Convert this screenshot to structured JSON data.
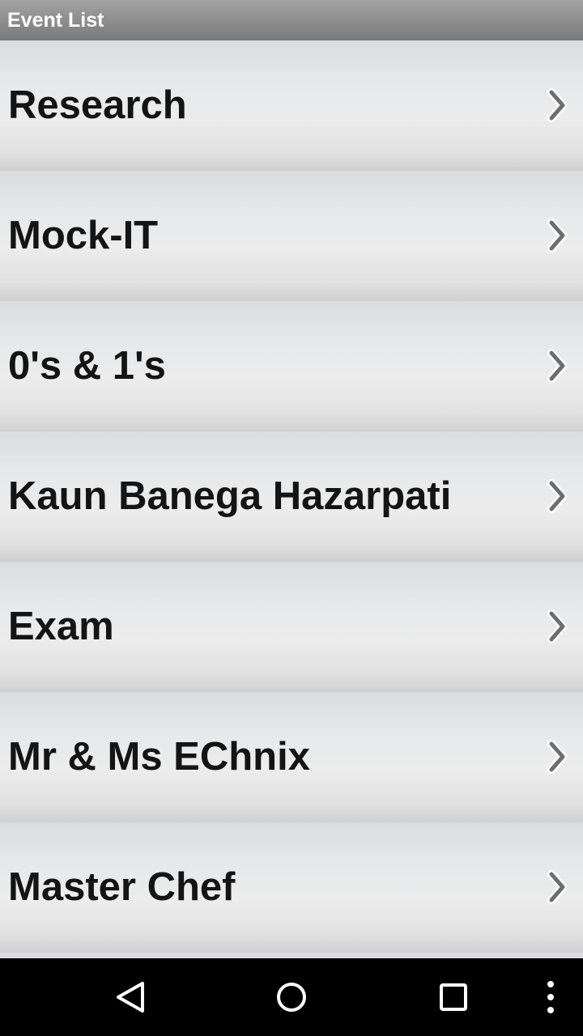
{
  "header": {
    "title": "Event List"
  },
  "events": [
    {
      "label": "Research"
    },
    {
      "label": "Mock-IT"
    },
    {
      "label": "0's & 1's"
    },
    {
      "label": "Kaun Banega Hazarpati"
    },
    {
      "label": "Exam"
    },
    {
      "label": "Mr & Ms EChnix"
    },
    {
      "label": "Master Chef"
    }
  ],
  "icons": {
    "row_chevron": "chevron-right-icon",
    "nav_back": "back-triangle-icon",
    "nav_home": "home-circle-icon",
    "nav_recents": "recents-square-icon",
    "nav_overflow": "overflow-dots-icon"
  },
  "colors": {
    "title_bar": "#8c8c8c",
    "title_text": "#ffffff",
    "row_text": "#141414",
    "nav_bar": "#000000",
    "nav_icons": "#ffffff"
  }
}
